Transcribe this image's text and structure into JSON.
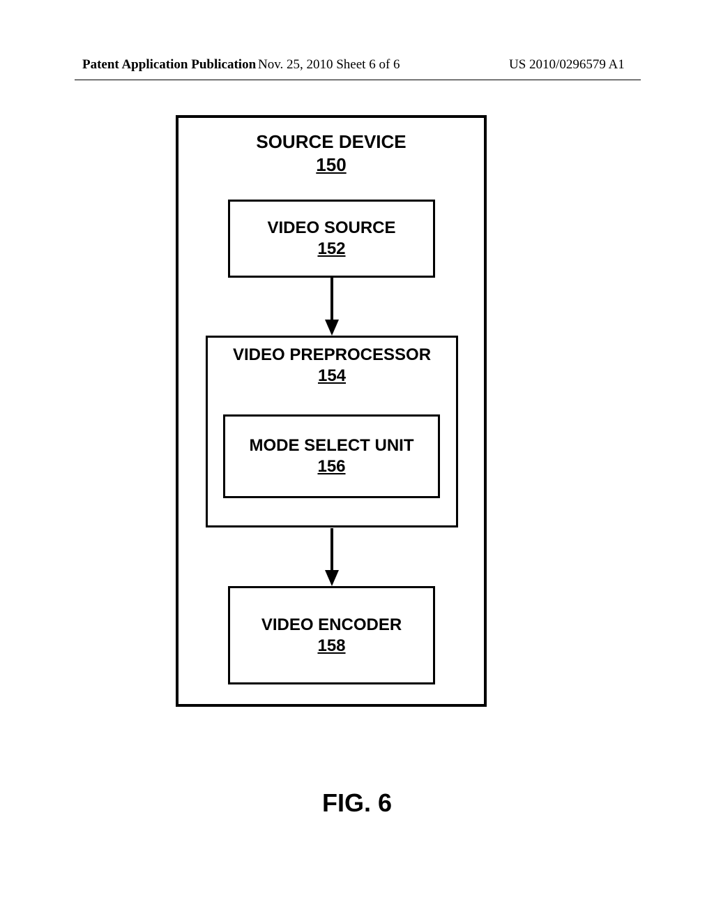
{
  "header": {
    "left": "Patent Application Publication",
    "center": "Nov. 25, 2010  Sheet 6 of 6",
    "right": "US 2010/0296579 A1"
  },
  "device": {
    "title": "SOURCE DEVICE",
    "num": "150"
  },
  "video_source": {
    "title": "VIDEO SOURCE",
    "num": "152"
  },
  "preprocessor": {
    "title": "VIDEO PREPROCESSOR",
    "num": "154"
  },
  "mode_select": {
    "title": "MODE SELECT UNIT",
    "num": "156"
  },
  "encoder": {
    "title": "VIDEO ENCODER",
    "num": "158"
  },
  "figure_caption": "FIG. 6"
}
